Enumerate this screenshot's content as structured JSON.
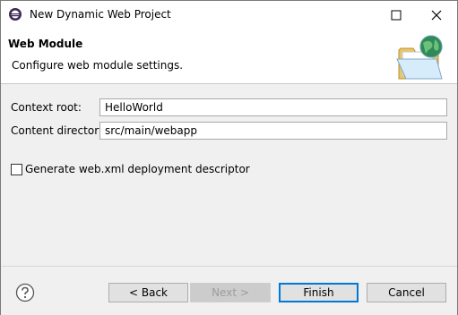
{
  "window": {
    "title": "New Dynamic Web Project"
  },
  "banner": {
    "title": "Web Module",
    "description": "Configure web module settings."
  },
  "form": {
    "context_root_label": "Context root:",
    "context_root_value": "HelloWorld",
    "content_directory_label": "Content directory:",
    "content_directory_value": "src/main/webapp",
    "generate_descriptor_label": "Generate web.xml deployment descriptor",
    "generate_descriptor_checked": false
  },
  "footer": {
    "help_icon": "help-icon",
    "back_label": "< Back",
    "next_label": "Next >",
    "finish_label": "Finish",
    "cancel_label": "Cancel"
  },
  "colors": {
    "focus_accent": "#0078d7",
    "window_bg": "#f0f0f0"
  }
}
